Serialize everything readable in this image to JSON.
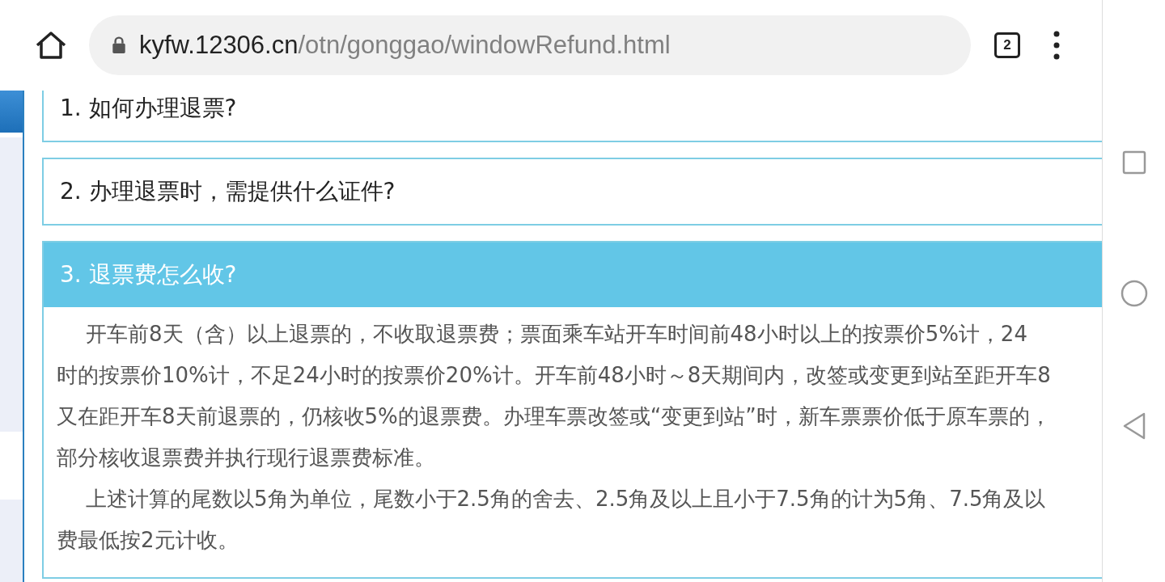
{
  "address_bar": {
    "host": "kyfw.12306.cn",
    "path": "/otn/gonggao/windowRefund.html",
    "tab_count": "2"
  },
  "sections": [
    {
      "title": "1. 如何办理退票?",
      "expanded": false
    },
    {
      "title": "2. 办理退票时，需提供什么证件?",
      "expanded": false
    },
    {
      "title": "3. 退票费怎么收?",
      "expanded": true,
      "paragraphs": [
        [
          "开车前8天（含）以上退票的，不收取退票费；票面乘车站开车时间前48小时以上的按票价5%计，24",
          "时的按票价10%计，不足24小时的按票价20%计。开车前48小时～8天期间内，改签或变更到站至距开车8",
          "又在距开车8天前退票的，仍核收5%的退票费。办理车票改签或“变更到站”时，新车票票价低于原车票的，",
          "部分核收退票费并执行现行退票费标准。"
        ],
        [
          "上述计算的尾数以5角为单位，尾数小于2.5角的舍去、2.5角及以上且小于7.5角的计为5角、7.5角及以",
          "费最低按2元计收。"
        ]
      ]
    }
  ]
}
